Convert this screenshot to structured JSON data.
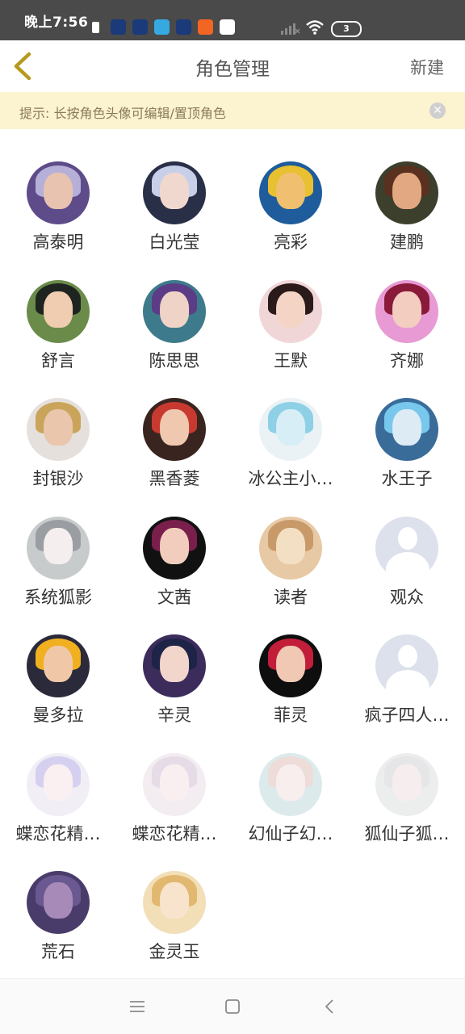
{
  "status_bar": {
    "time": "晚上7:56",
    "battery": "3",
    "app_icon_colors": [
      "#1a3a7a",
      "#1a3a7a",
      "#36a9e1",
      "#1a3a7a",
      "#f26522",
      "#ffffff"
    ]
  },
  "header": {
    "title": "角色管理",
    "new_label": "新建",
    "back_icon": "chevron-left-icon",
    "accent_color": "#b59a1e"
  },
  "tip": {
    "text": "提示: 长按角色头像可编辑/置顶角色",
    "close_icon": "close-icon"
  },
  "roles": [
    {
      "name": "高泰明",
      "bg": "#5e4b8a",
      "face": "#e8c4b0",
      "hair": "#b6b0d8",
      "placeholder": false
    },
    {
      "name": "白光莹",
      "bg": "#2a2f48",
      "face": "#f1d8cf",
      "hair": "#c8cfe8",
      "placeholder": false
    },
    {
      "name": "亮彩",
      "bg": "#1f5c9c",
      "face": "#f0c070",
      "hair": "#e8c030",
      "placeholder": false
    },
    {
      "name": "建鹏",
      "bg": "#3b3f2c",
      "face": "#e2a882",
      "hair": "#5a3020",
      "placeholder": false
    },
    {
      "name": "舒言",
      "bg": "#6b8b4a",
      "face": "#f0cdb0",
      "hair": "#1e2420",
      "placeholder": false
    },
    {
      "name": "陈思思",
      "bg": "#3d7a8c",
      "face": "#efd3c6",
      "hair": "#5c3c86",
      "placeholder": false
    },
    {
      "name": "王默",
      "bg": "#f1d6d8",
      "face": "#f4d4c4",
      "hair": "#2a1a1a",
      "placeholder": false
    },
    {
      "name": "齐娜",
      "bg": "#e79ad4",
      "face": "#f2cdc0",
      "hair": "#8a1a3a",
      "placeholder": false
    },
    {
      "name": "封银沙",
      "bg": "#e6e0dc",
      "face": "#e9c6ac",
      "hair": "#c9a45a",
      "placeholder": false
    },
    {
      "name": "黑香菱",
      "bg": "#3a2420",
      "face": "#f0c8b0",
      "hair": "#c83a30",
      "placeholder": false
    },
    {
      "name": "冰公主小…",
      "bg": "#eaf2f6",
      "face": "#d8eef6",
      "hair": "#8ed0e6",
      "placeholder": false
    },
    {
      "name": "水王子",
      "bg": "#3a6c9a",
      "face": "#dcebf4",
      "hair": "#78c8ee",
      "placeholder": false
    },
    {
      "name": "系统狐影",
      "bg": "#c8cbcc",
      "face": "#f4eeee",
      "hair": "#9a9ea2",
      "placeholder": false
    },
    {
      "name": "文茜",
      "bg": "#111111",
      "face": "#f2cdbd",
      "hair": "#7a1e4c",
      "placeholder": false
    },
    {
      "name": "读者",
      "bg": "#e8c9a6",
      "face": "#f3e0c4",
      "hair": "#c89a6a",
      "placeholder": false
    },
    {
      "name": "观众",
      "bg": "#dde1ec",
      "face": "#ffffff",
      "hair": "#ffffff",
      "placeholder": true
    },
    {
      "name": "曼多拉",
      "bg": "#2a2a3a",
      "face": "#f0c8a8",
      "hair": "#f0b020",
      "placeholder": false
    },
    {
      "name": "辛灵",
      "bg": "#3c2c5c",
      "face": "#f2d6cc",
      "hair": "#1e2448",
      "placeholder": false
    },
    {
      "name": "菲灵",
      "bg": "#0e0e0e",
      "face": "#f1c8b4",
      "hair": "#c21e3a",
      "placeholder": false
    },
    {
      "name": "疯子四人…",
      "bg": "#dde1ec",
      "face": "#ffffff",
      "hair": "#ffffff",
      "placeholder": true
    },
    {
      "name": "蝶恋花精…",
      "bg": "#f1eef6",
      "face": "#faf0f2",
      "hair": "#d6d0f0",
      "placeholder": false
    },
    {
      "name": "蝶恋花精…",
      "bg": "#f3ecf0",
      "face": "#faeff0",
      "hair": "#e6dce8",
      "placeholder": false
    },
    {
      "name": "幻仙子幻…",
      "bg": "#dceaec",
      "face": "#f8eeee",
      "hair": "#eedcd8",
      "placeholder": false
    },
    {
      "name": "狐仙子狐…",
      "bg": "#eceeee",
      "face": "#f6eeee",
      "hair": "#e6e6e8",
      "placeholder": false
    },
    {
      "name": "荒石",
      "bg": "#4a3c6a",
      "face": "#a88ab8",
      "hair": "#6a5890",
      "placeholder": false
    },
    {
      "name": "金灵玉",
      "bg": "#f2dfb8",
      "face": "#f8e4cc",
      "hair": "#e2b870",
      "placeholder": false
    }
  ],
  "nav": {
    "menu_icon": "menu-icon",
    "home_icon": "home-icon",
    "back_icon": "back-icon"
  }
}
